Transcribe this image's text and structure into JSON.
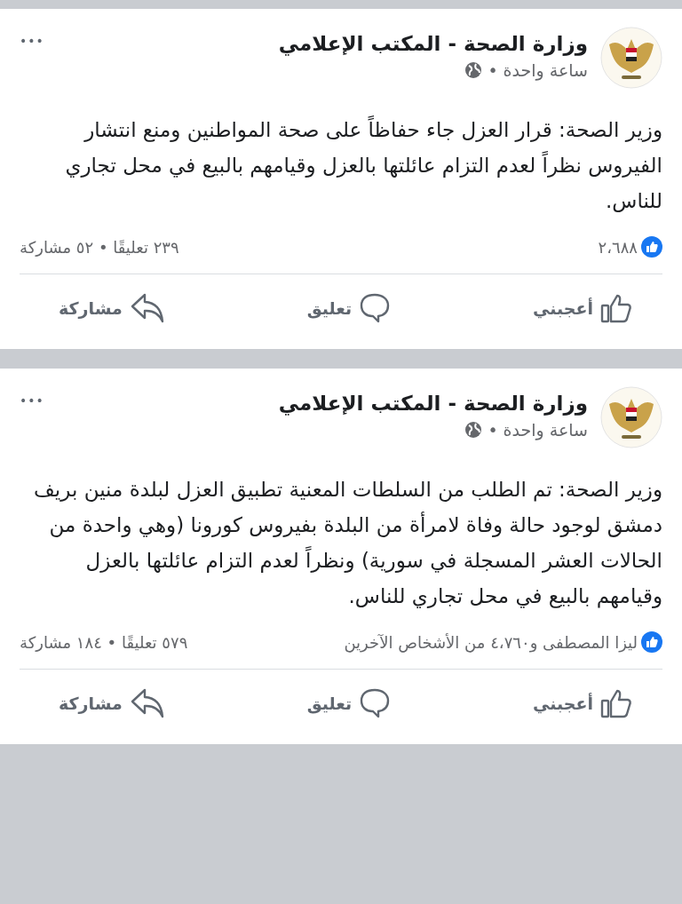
{
  "posts": [
    {
      "author": "وزارة الصحة - المكتب الإعلامي",
      "time": "ساعة واحدة",
      "dot": "•",
      "more": "•••",
      "text": "وزير الصحة: قرار العزل جاء حفاظاً على صحة المواطنين ومنع انتشار الفيروس نظراً لعدم التزام عائلتها بالعزل وقيامهم بالبيع في محل تجاري للناس.",
      "reactions": "٢،٦٨٨",
      "counts": "٢٣٩ تعليقًا • ٥٢ مشاركة",
      "actions": [
        {
          "kind": "like",
          "label": "أعجبني"
        },
        {
          "kind": "comment",
          "label": "تعليق"
        },
        {
          "kind": "share",
          "label": "مشاركة"
        }
      ]
    },
    {
      "author": "وزارة الصحة - المكتب الإعلامي",
      "time": "ساعة واحدة",
      "dot": "•",
      "more": "•••",
      "text": "وزير الصحة: تم الطلب من السلطات المعنية تطبيق العزل لبلدة منين بريف دمشق لوجود حالة وفاة لامرأة من البلدة بفيروس كورونا (وهي واحدة من الحالات العشر المسجلة في سورية) ونظراً لعدم التزام عائلتها بالعزل وقيامهم بالبيع في محل تجاري للناس.",
      "reactions": "ليزا المصطفى و٤،٧٦٠ من الأشخاص الآخرين",
      "counts": "٥٧٩ تعليقًا • ١٨٤ مشاركة",
      "actions": [
        {
          "kind": "like",
          "label": "أعجبني"
        },
        {
          "kind": "comment",
          "label": "تعليق"
        },
        {
          "kind": "share",
          "label": "مشاركة"
        }
      ]
    }
  ]
}
